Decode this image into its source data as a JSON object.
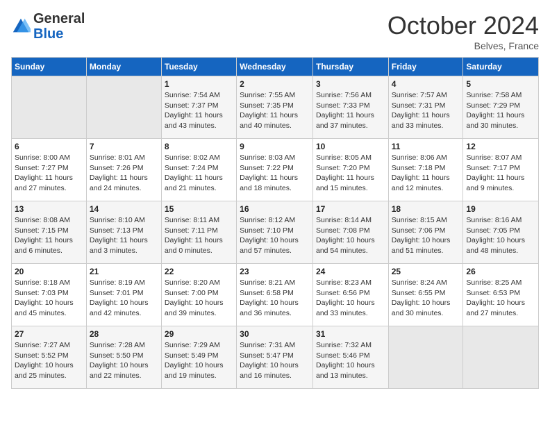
{
  "header": {
    "logo_general": "General",
    "logo_blue": "Blue",
    "month_year": "October 2024",
    "location": "Belves, France"
  },
  "weekdays": [
    "Sunday",
    "Monday",
    "Tuesday",
    "Wednesday",
    "Thursday",
    "Friday",
    "Saturday"
  ],
  "weeks": [
    [
      {
        "day": "",
        "sunrise": "",
        "sunset": "",
        "daylight": ""
      },
      {
        "day": "",
        "sunrise": "",
        "sunset": "",
        "daylight": ""
      },
      {
        "day": "1",
        "sunrise": "Sunrise: 7:54 AM",
        "sunset": "Sunset: 7:37 PM",
        "daylight": "Daylight: 11 hours and 43 minutes."
      },
      {
        "day": "2",
        "sunrise": "Sunrise: 7:55 AM",
        "sunset": "Sunset: 7:35 PM",
        "daylight": "Daylight: 11 hours and 40 minutes."
      },
      {
        "day": "3",
        "sunrise": "Sunrise: 7:56 AM",
        "sunset": "Sunset: 7:33 PM",
        "daylight": "Daylight: 11 hours and 37 minutes."
      },
      {
        "day": "4",
        "sunrise": "Sunrise: 7:57 AM",
        "sunset": "Sunset: 7:31 PM",
        "daylight": "Daylight: 11 hours and 33 minutes."
      },
      {
        "day": "5",
        "sunrise": "Sunrise: 7:58 AM",
        "sunset": "Sunset: 7:29 PM",
        "daylight": "Daylight: 11 hours and 30 minutes."
      }
    ],
    [
      {
        "day": "6",
        "sunrise": "Sunrise: 8:00 AM",
        "sunset": "Sunset: 7:27 PM",
        "daylight": "Daylight: 11 hours and 27 minutes."
      },
      {
        "day": "7",
        "sunrise": "Sunrise: 8:01 AM",
        "sunset": "Sunset: 7:26 PM",
        "daylight": "Daylight: 11 hours and 24 minutes."
      },
      {
        "day": "8",
        "sunrise": "Sunrise: 8:02 AM",
        "sunset": "Sunset: 7:24 PM",
        "daylight": "Daylight: 11 hours and 21 minutes."
      },
      {
        "day": "9",
        "sunrise": "Sunrise: 8:03 AM",
        "sunset": "Sunset: 7:22 PM",
        "daylight": "Daylight: 11 hours and 18 minutes."
      },
      {
        "day": "10",
        "sunrise": "Sunrise: 8:05 AM",
        "sunset": "Sunset: 7:20 PM",
        "daylight": "Daylight: 11 hours and 15 minutes."
      },
      {
        "day": "11",
        "sunrise": "Sunrise: 8:06 AM",
        "sunset": "Sunset: 7:18 PM",
        "daylight": "Daylight: 11 hours and 12 minutes."
      },
      {
        "day": "12",
        "sunrise": "Sunrise: 8:07 AM",
        "sunset": "Sunset: 7:17 PM",
        "daylight": "Daylight: 11 hours and 9 minutes."
      }
    ],
    [
      {
        "day": "13",
        "sunrise": "Sunrise: 8:08 AM",
        "sunset": "Sunset: 7:15 PM",
        "daylight": "Daylight: 11 hours and 6 minutes."
      },
      {
        "day": "14",
        "sunrise": "Sunrise: 8:10 AM",
        "sunset": "Sunset: 7:13 PM",
        "daylight": "Daylight: 11 hours and 3 minutes."
      },
      {
        "day": "15",
        "sunrise": "Sunrise: 8:11 AM",
        "sunset": "Sunset: 7:11 PM",
        "daylight": "Daylight: 11 hours and 0 minutes."
      },
      {
        "day": "16",
        "sunrise": "Sunrise: 8:12 AM",
        "sunset": "Sunset: 7:10 PM",
        "daylight": "Daylight: 10 hours and 57 minutes."
      },
      {
        "day": "17",
        "sunrise": "Sunrise: 8:14 AM",
        "sunset": "Sunset: 7:08 PM",
        "daylight": "Daylight: 10 hours and 54 minutes."
      },
      {
        "day": "18",
        "sunrise": "Sunrise: 8:15 AM",
        "sunset": "Sunset: 7:06 PM",
        "daylight": "Daylight: 10 hours and 51 minutes."
      },
      {
        "day": "19",
        "sunrise": "Sunrise: 8:16 AM",
        "sunset": "Sunset: 7:05 PM",
        "daylight": "Daylight: 10 hours and 48 minutes."
      }
    ],
    [
      {
        "day": "20",
        "sunrise": "Sunrise: 8:18 AM",
        "sunset": "Sunset: 7:03 PM",
        "daylight": "Daylight: 10 hours and 45 minutes."
      },
      {
        "day": "21",
        "sunrise": "Sunrise: 8:19 AM",
        "sunset": "Sunset: 7:01 PM",
        "daylight": "Daylight: 10 hours and 42 minutes."
      },
      {
        "day": "22",
        "sunrise": "Sunrise: 8:20 AM",
        "sunset": "Sunset: 7:00 PM",
        "daylight": "Daylight: 10 hours and 39 minutes."
      },
      {
        "day": "23",
        "sunrise": "Sunrise: 8:21 AM",
        "sunset": "Sunset: 6:58 PM",
        "daylight": "Daylight: 10 hours and 36 minutes."
      },
      {
        "day": "24",
        "sunrise": "Sunrise: 8:23 AM",
        "sunset": "Sunset: 6:56 PM",
        "daylight": "Daylight: 10 hours and 33 minutes."
      },
      {
        "day": "25",
        "sunrise": "Sunrise: 8:24 AM",
        "sunset": "Sunset: 6:55 PM",
        "daylight": "Daylight: 10 hours and 30 minutes."
      },
      {
        "day": "26",
        "sunrise": "Sunrise: 8:25 AM",
        "sunset": "Sunset: 6:53 PM",
        "daylight": "Daylight: 10 hours and 27 minutes."
      }
    ],
    [
      {
        "day": "27",
        "sunrise": "Sunrise: 7:27 AM",
        "sunset": "Sunset: 5:52 PM",
        "daylight": "Daylight: 10 hours and 25 minutes."
      },
      {
        "day": "28",
        "sunrise": "Sunrise: 7:28 AM",
        "sunset": "Sunset: 5:50 PM",
        "daylight": "Daylight: 10 hours and 22 minutes."
      },
      {
        "day": "29",
        "sunrise": "Sunrise: 7:29 AM",
        "sunset": "Sunset: 5:49 PM",
        "daylight": "Daylight: 10 hours and 19 minutes."
      },
      {
        "day": "30",
        "sunrise": "Sunrise: 7:31 AM",
        "sunset": "Sunset: 5:47 PM",
        "daylight": "Daylight: 10 hours and 16 minutes."
      },
      {
        "day": "31",
        "sunrise": "Sunrise: 7:32 AM",
        "sunset": "Sunset: 5:46 PM",
        "daylight": "Daylight: 10 hours and 13 minutes."
      },
      {
        "day": "",
        "sunrise": "",
        "sunset": "",
        "daylight": ""
      },
      {
        "day": "",
        "sunrise": "",
        "sunset": "",
        "daylight": ""
      }
    ]
  ]
}
